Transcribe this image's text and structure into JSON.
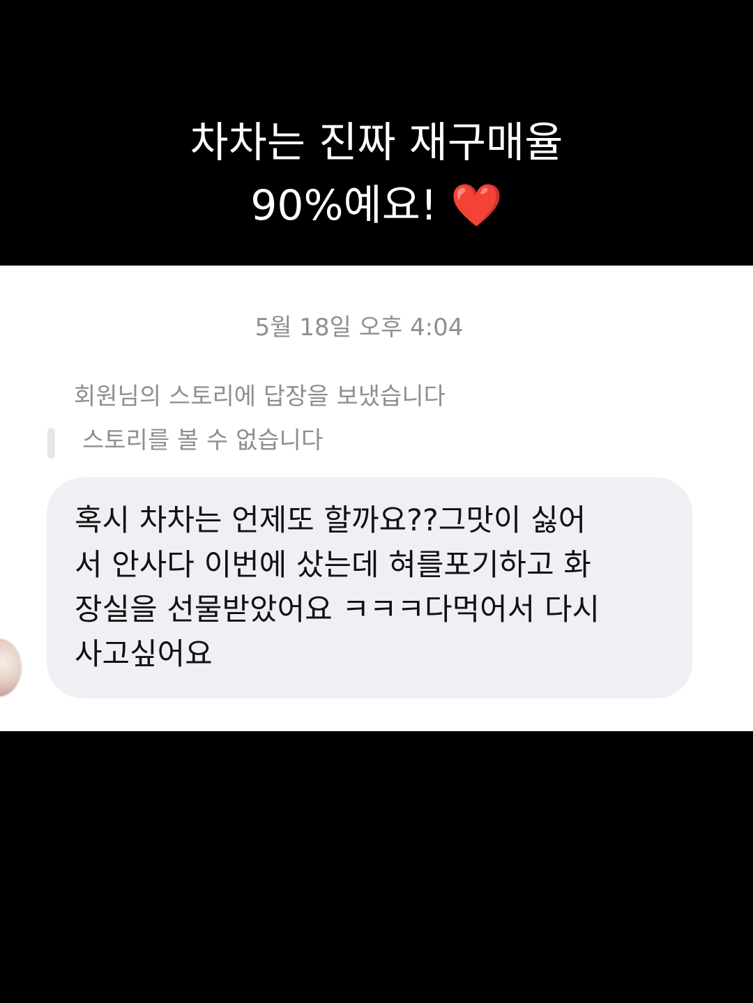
{
  "caption": {
    "line1": "차차는 진짜 재구매율",
    "line2": "90%예요!",
    "heart": "❤️"
  },
  "conversation": {
    "timestamp": "5월 18일 오후 4:04",
    "reply_note": "회원님의 스토리에 답장을 보냈습니다",
    "story_unavailable": "스토리를 볼 수 없습니다",
    "message": "혹시 차차는 언제또 할까요??그맛이 싫어\n서 안사다 이번에 샀는데 혀를포기하고 화\n장실을 선물받았어요 ㅋㅋㅋ다먹어서 다시\n사고싶어요"
  }
}
